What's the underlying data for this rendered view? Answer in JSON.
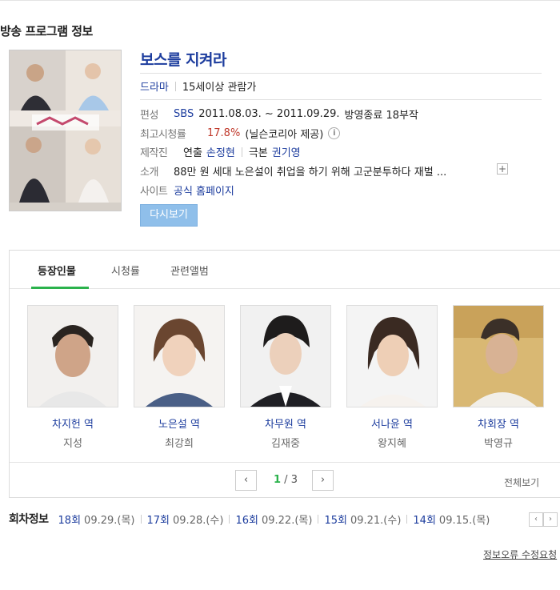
{
  "section_title": "방송 프로그램 정보",
  "program": {
    "title": "보스를 지켜라",
    "genre": "드라마",
    "rating": "15세이상 관람가",
    "schedule": {
      "label": "편성",
      "channel": "SBS",
      "period": "2011.08.03. ~ 2011.09.29.",
      "status": "방영종료 18부작"
    },
    "peak_rating": {
      "label": "최고시청률",
      "value": "17.8%",
      "source": "(닐슨코리아 제공)"
    },
    "production": {
      "label": "제작진",
      "director_label": "연출",
      "director": "손정현",
      "writer_label": "극본",
      "writer": "권기영"
    },
    "intro": {
      "label": "소개",
      "text": "88만 원 세대 노은설이 취업을 하기 위해 고군분투하다 재벌 ..."
    },
    "site": {
      "label": "사이트",
      "link": "공식 홈페이지"
    },
    "rewatch_button": "다시보기"
  },
  "tabs": [
    {
      "label": "등장인물"
    },
    {
      "label": "시청률"
    },
    {
      "label": "관련앨범"
    }
  ],
  "cast": [
    {
      "role": "차지헌 역",
      "actor": "지성"
    },
    {
      "role": "노은설 역",
      "actor": "최강희"
    },
    {
      "role": "차무원 역",
      "actor": "김재중"
    },
    {
      "role": "서나윤 역",
      "actor": "왕지혜"
    },
    {
      "role": "차회장 역",
      "actor": "박영규"
    }
  ],
  "pager": {
    "current": "1",
    "total": " / 3",
    "prev_icon": "chevron-left-icon",
    "next_icon": "chevron-right-icon"
  },
  "view_all": "전체보기",
  "episodes": {
    "title": "회차정보",
    "items": [
      {
        "num": "18회",
        "date": "09.29.(목)"
      },
      {
        "num": "17회",
        "date": "09.28.(수)"
      },
      {
        "num": "16회",
        "date": "09.22.(목)"
      },
      {
        "num": "15회",
        "date": "09.21.(수)"
      },
      {
        "num": "14회",
        "date": "09.15.(목)"
      }
    ]
  },
  "report_link": "정보오류 수정요청",
  "colors": {
    "link": "#1d3d9e",
    "accent_green": "#2bb24c",
    "button_blue": "#8fbfea",
    "rating_red": "#c0392b"
  }
}
